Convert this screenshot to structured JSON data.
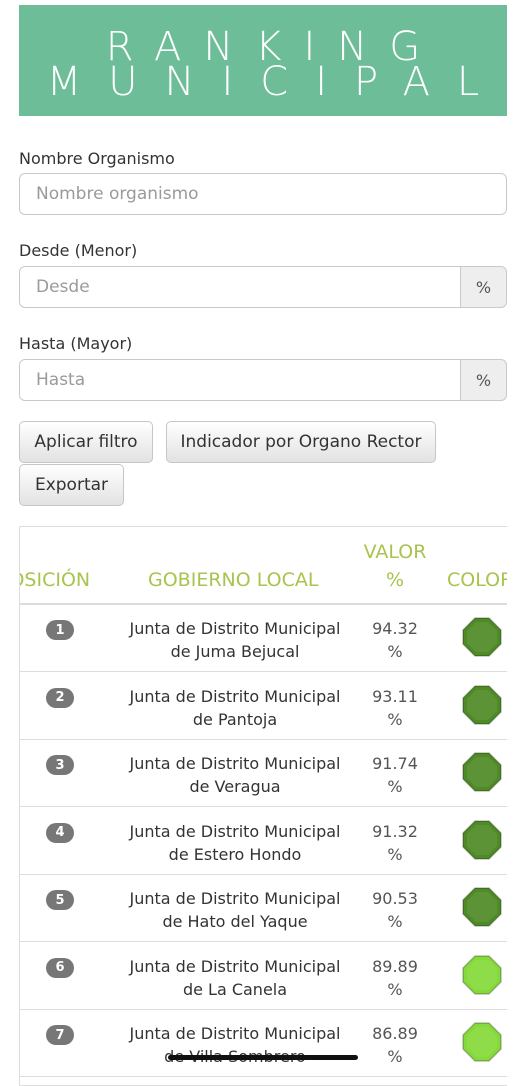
{
  "banner": {
    "line1": "RANKING",
    "line2": "MUNICIPAL"
  },
  "filters": {
    "nombre_label": "Nombre Organismo",
    "nombre_placeholder": "Nombre organismo",
    "desde_label": "Desde (Menor)",
    "desde_placeholder": "Desde",
    "hasta_label": "Hasta (Mayor)",
    "hasta_placeholder": "Hasta",
    "percent_addon": "%"
  },
  "buttons": {
    "aplicar": "Aplicar filtro",
    "indicador": "Indicador por Organo Rector",
    "exportar": "Exportar"
  },
  "table": {
    "headers": {
      "posicion": "POSICIÓN",
      "gobierno": "GOBIERNO LOCAL",
      "valor_1": "VALOR",
      "valor_2": "%",
      "color": "COLOR"
    },
    "rows": [
      {
        "rank": "1",
        "name_1": "Junta de Distrito Municipal",
        "name_2": "de Juma Bejucal",
        "value": "94.32",
        "unit": "%",
        "color": "#4e8a25"
      },
      {
        "rank": "2",
        "name_1": "Junta de Distrito Municipal",
        "name_2": "de Pantoja",
        "value": "93.11",
        "unit": "%",
        "color": "#4e8a25"
      },
      {
        "rank": "3",
        "name_1": "Junta de Distrito Municipal",
        "name_2": "de Veragua",
        "value": "91.74",
        "unit": "%",
        "color": "#4e8a25"
      },
      {
        "rank": "4",
        "name_1": "Junta de Distrito Municipal",
        "name_2": "de Estero Hondo",
        "value": "91.32",
        "unit": "%",
        "color": "#4e8a25"
      },
      {
        "rank": "5",
        "name_1": "Junta de Distrito Municipal",
        "name_2": "de Hato del Yaque",
        "value": "90.53",
        "unit": "%",
        "color": "#4e8a25"
      },
      {
        "rank": "6",
        "name_1": "Junta de Distrito Municipal",
        "name_2": "de La Canela",
        "value": "89.89",
        "unit": "%",
        "color": "#86d93a"
      },
      {
        "rank": "7",
        "name_1": "Junta de Distrito Municipal",
        "name_2": "de Villa Sombrero",
        "value": "86.89",
        "unit": "%",
        "color": "#86d93a"
      }
    ]
  }
}
